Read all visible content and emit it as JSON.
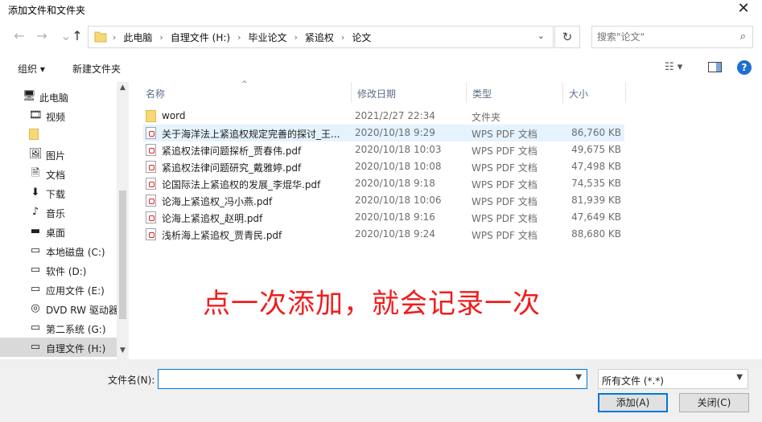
{
  "window": {
    "title": "添加文件和文件夹",
    "close_glyph": "✕"
  },
  "nav": {
    "back": "←",
    "forward": "→",
    "up": "↑"
  },
  "address": {
    "crumbs": [
      "此电脑",
      "自理文件 (H:)",
      "毕业论文",
      "紧追权",
      "论文"
    ],
    "separator": "›",
    "dropdown": "⌄"
  },
  "refresh_glyph": "↻",
  "search": {
    "placeholder": "搜索\"论文\"",
    "icon": "search-icon"
  },
  "toolbar": {
    "organize_label": "组织 ▾",
    "new_folder_label": "新建文件夹",
    "view_glyph": "☷ ▾",
    "help_glyph": "?"
  },
  "sidebar": {
    "items": [
      {
        "label": "此电脑",
        "icon": "computer-icon",
        "glyph": "🖥",
        "top": true
      },
      {
        "label": "视频",
        "icon": "video-icon",
        "glyph": "🎞"
      },
      {
        "label": "",
        "icon": "folder-icon",
        "glyph": "📁"
      },
      {
        "label": "图片",
        "icon": "pictures-icon",
        "glyph": "🖼"
      },
      {
        "label": "文档",
        "icon": "documents-icon",
        "glyph": "🗎"
      },
      {
        "label": "下载",
        "icon": "download-icon",
        "glyph": "⬇"
      },
      {
        "label": "音乐",
        "icon": "music-icon",
        "glyph": "♪"
      },
      {
        "label": "桌面",
        "icon": "desktop-icon",
        "glyph": "▬"
      },
      {
        "label": "本地磁盘 (C:)",
        "icon": "drive-icon",
        "glyph": "▭"
      },
      {
        "label": "软件 (D:)",
        "icon": "drive-icon",
        "glyph": "▭"
      },
      {
        "label": "应用文件 (E:)",
        "icon": "drive-icon",
        "glyph": "▭"
      },
      {
        "label": "DVD RW 驱动器",
        "icon": "dvd-icon",
        "glyph": "◎"
      },
      {
        "label": "第二系统 (G:)",
        "icon": "drive-icon",
        "glyph": "▭"
      },
      {
        "label": "自理文件 (H:)",
        "icon": "drive-icon",
        "glyph": "▭",
        "selected": true
      }
    ]
  },
  "columns": {
    "name": "名称",
    "date": "修改日期",
    "type": "类型",
    "size": "大小"
  },
  "files": [
    {
      "name": "word",
      "date": "2021/2/27 22:34",
      "type": "文件夹",
      "size": "",
      "kind": "folder"
    },
    {
      "name": "关于海洋法上紧追权规定完善的探讨_王...",
      "date": "2020/10/18 9:29",
      "type": "WPS PDF 文档",
      "size": "86,760 KB",
      "kind": "pdf",
      "highlight": true
    },
    {
      "name": "紧追权法律问题探析_贾春伟.pdf",
      "date": "2020/10/18 10:03",
      "type": "WPS PDF 文档",
      "size": "49,675 KB",
      "kind": "pdf"
    },
    {
      "name": "紧追权法律问题研究_戴雅婷.pdf",
      "date": "2020/10/18 10:08",
      "type": "WPS PDF 文档",
      "size": "47,498 KB",
      "kind": "pdf"
    },
    {
      "name": "论国际法上紧追权的发展_李焜华.pdf",
      "date": "2020/10/18 9:18",
      "type": "WPS PDF 文档",
      "size": "74,535 KB",
      "kind": "pdf"
    },
    {
      "name": "论海上紧追权_冯小燕.pdf",
      "date": "2020/10/18 10:06",
      "type": "WPS PDF 文档",
      "size": "81,939 KB",
      "kind": "pdf"
    },
    {
      "name": "论海上紧追权_赵明.pdf",
      "date": "2020/10/18 9:16",
      "type": "WPS PDF 文档",
      "size": "47,649 KB",
      "kind": "pdf"
    },
    {
      "name": "浅析海上紧追权_贾青民.pdf",
      "date": "2020/10/18 9:24",
      "type": "WPS PDF 文档",
      "size": "88,680 KB",
      "kind": "pdf"
    }
  ],
  "annotation": "点一次添加，就会记录一次",
  "footer": {
    "filename_label": "文件名(N):",
    "filename_value": "",
    "filter_value": "所有文件 (*.*)",
    "add_label": "添加(A)",
    "cancel_label": "关闭(C)"
  },
  "colors": {
    "accent": "#0078d7",
    "annotation": "#f21c1c",
    "highlight_row": "#e5f3ff"
  }
}
